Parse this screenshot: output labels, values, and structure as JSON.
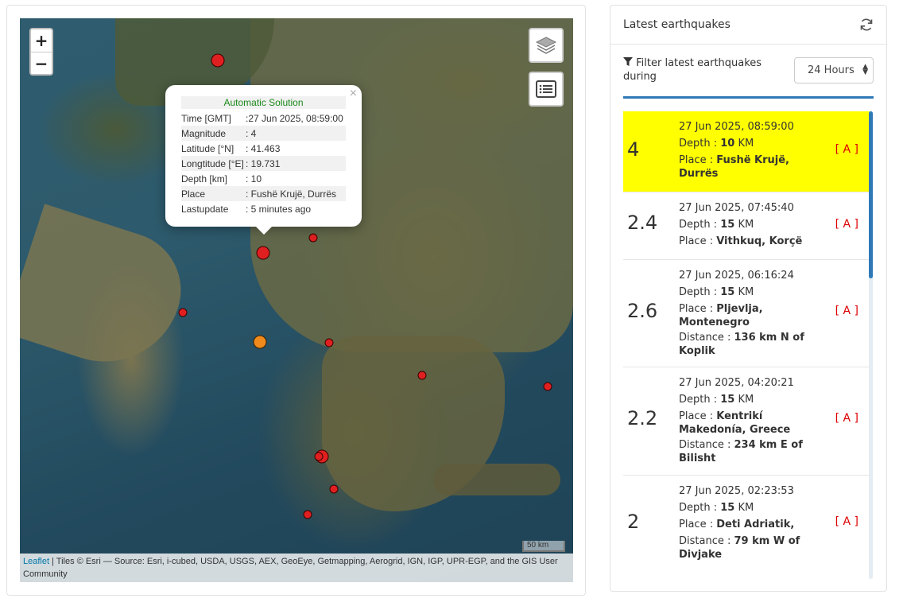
{
  "map": {
    "zoom_in": "+",
    "zoom_out": "−",
    "scale_label": "50 km",
    "attribution_link": "Leaflet",
    "attribution_text": " | Tiles © Esri — Source: Esri, i-cubed, USDA, USGS, AEX, GeoEye, Getmapping, Aerogrid, IGN, IGP, UPR-EGP, and the GIS User Community",
    "popup": {
      "close": "×",
      "title": "Automatic Solution",
      "rows": [
        {
          "k": "Time [GMT]",
          "v": ":27 Jun 2025, 08:59:00"
        },
        {
          "k": "Magnitude",
          "v": ": 4"
        },
        {
          "k": "Latitude [°N]",
          "v": ": 41.463"
        },
        {
          "k": "Longtitude [°E]",
          "v": ": 19.731"
        },
        {
          "k": "Depth [km]",
          "v": ": 10"
        },
        {
          "k": "Place",
          "v": ": Fushë Krujë, Durrës"
        },
        {
          "k": "Lastupdate",
          "v": ": 5 minutes ago"
        }
      ]
    }
  },
  "panel": {
    "title": "Latest earthquakes",
    "filter_label": "Filter latest earthquakes during",
    "filter_value": "24 Hours",
    "quakes": [
      {
        "mag": "4",
        "time": "27 Jun 2025, 08:59:00",
        "depth_label": "Depth : ",
        "depth": "10",
        "unit": " KM",
        "place_label": "Place : ",
        "place": "Fushë Krujë, Durrës",
        "distance_label": "",
        "distance": "",
        "auto": "[ A ]"
      },
      {
        "mag": "2.4",
        "time": "27 Jun 2025, 07:45:40",
        "depth_label": "Depth : ",
        "depth": "15",
        "unit": " KM",
        "place_label": "Place : ",
        "place": "Vithkuq, Korçë",
        "distance_label": "",
        "distance": "",
        "auto": "[ A ]"
      },
      {
        "mag": "2.6",
        "time": "27 Jun 2025, 06:16:24",
        "depth_label": "Depth : ",
        "depth": "15",
        "unit": " KM",
        "place_label": "Place : ",
        "place": "Pljevlja, Montenegro",
        "distance_label": "Distance : ",
        "distance": "136 km N of Koplik",
        "auto": "[ A ]"
      },
      {
        "mag": "2.2",
        "time": "27 Jun 2025, 04:20:21",
        "depth_label": "Depth : ",
        "depth": "15",
        "unit": " KM",
        "place_label": "Place : ",
        "place": "Kentrikí Makedonía, Greece",
        "distance_label": "Distance : ",
        "distance": "234 km E of Bilisht",
        "auto": "[ A ]"
      },
      {
        "mag": "2",
        "time": "27 Jun 2025, 02:23:53",
        "depth_label": "Depth : ",
        "depth": "15",
        "unit": " KM",
        "place_label": "Place : ",
        "place": "Deti Adriatik,",
        "distance_label": "Distance : ",
        "distance": "79 km W of Divjake",
        "auto": "[ A ]"
      }
    ]
  },
  "colors": {
    "highlight": "#ffff00",
    "accent": "#2f79b7",
    "marker_red": "#e02020",
    "marker_orange": "#f08a1c"
  },
  "icons": [
    "refresh-icon",
    "filter-icon",
    "layers-icon",
    "list-icon",
    "close-icon"
  ]
}
